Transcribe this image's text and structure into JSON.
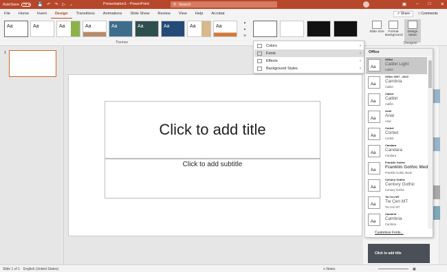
{
  "titlebar": {
    "autosave_label": "AutoSave",
    "autosave_state": "Off",
    "doc_title": "Presentation1 - PowerPoint",
    "search_placeholder": "Search"
  },
  "tabs": [
    "File",
    "Home",
    "Insert",
    "Design",
    "Transitions",
    "Animations",
    "Slide Show",
    "Review",
    "View",
    "Help",
    "Acrobat"
  ],
  "active_tab": "Design",
  "share_label": "Share",
  "comments_label": "Comments",
  "ribbon": {
    "theme_preview_text": "Aa",
    "themes_label": "Themes",
    "slide_size_label": "Slide Size",
    "format_background_label": "Format Background",
    "design_ideas_label": "Design Ideas",
    "designer_label": "Designer"
  },
  "slide_panel": {
    "slide_number": "1"
  },
  "slide": {
    "title_placeholder": "Click to add title",
    "subtitle_placeholder": "Click to add subtitle"
  },
  "variants_menu": [
    {
      "label": "Colors",
      "has_submenu": true
    },
    {
      "label": "Fonts",
      "has_submenu": true,
      "highlighted": true
    },
    {
      "label": "Effects",
      "has_submenu": true
    },
    {
      "label": "Background Styles",
      "has_submenu": true
    }
  ],
  "fonts_menu": {
    "header": "Office",
    "preview_text": "Aa",
    "items": [
      {
        "name": "Office",
        "heading": "Calibri Light",
        "body": "Calibri",
        "selected": true
      },
      {
        "name": "Office 2007 - 2010",
        "heading": "Cambria",
        "body": "Calibri"
      },
      {
        "name": "Calibri",
        "heading": "Calibri",
        "body": "Calibri"
      },
      {
        "name": "Arial",
        "heading": "Arial",
        "body": "Arial"
      },
      {
        "name": "Corbel",
        "heading": "Corbel",
        "body": "Corbel"
      },
      {
        "name": "Candara",
        "heading": "Candara",
        "body": "Candara"
      },
      {
        "name": "Franklin Gothic",
        "heading": "Franklin Gothic Med",
        "body": "Franklin Gothic Book"
      },
      {
        "name": "Century Gothic",
        "heading": "Century Gothic",
        "body": "Century Gothic"
      },
      {
        "name": "Tw Cen MT",
        "heading": "Tw Cen MT",
        "body": "Tw Cen MT"
      },
      {
        "name": "Cambria",
        "heading": "Cambria",
        "body": "Cambria"
      }
    ],
    "customize_label": "Customize Fonts..."
  },
  "design_ideas": {
    "idea_caption": "Click to add title"
  },
  "statusbar": {
    "slide_info": "Slide 1 of 1",
    "language": "English (United States)",
    "notes_label": "Notes"
  },
  "colors": {
    "accent": "#b7472a",
    "selection_outline": "#d2632d"
  }
}
